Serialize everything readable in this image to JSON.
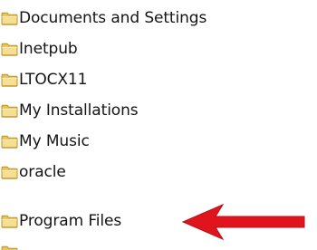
{
  "folders": [
    {
      "label": "Documents and Settings",
      "icon": "folder-icon"
    },
    {
      "label": "Inetpub",
      "icon": "folder-icon"
    },
    {
      "label": "LTOCX11",
      "icon": "folder-icon"
    },
    {
      "label": "My Installations",
      "icon": "folder-icon"
    },
    {
      "label": "My Music",
      "icon": "folder-icon"
    },
    {
      "label": "oracle",
      "icon": "folder-icon"
    },
    {
      "label": "Program Files",
      "icon": "folder-icon"
    }
  ],
  "colors": {
    "folder_body": "#f3d680",
    "folder_outline": "#b88a18",
    "folder_shade": "#e2b743",
    "arrow": "#e0141c",
    "text": "#141414"
  },
  "pointer": {
    "icon": "red-arrow-icon",
    "target": "Program Files"
  }
}
